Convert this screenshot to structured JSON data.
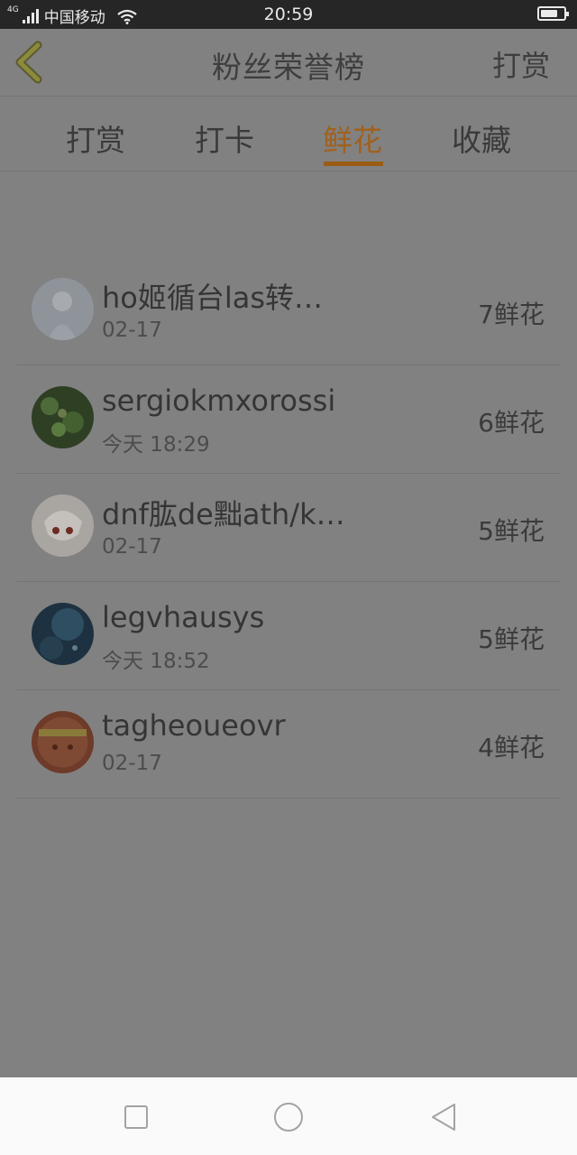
{
  "status_bar": {
    "network": "4G",
    "carrier": "中国移动",
    "time": "20:59",
    "battery_level": 0.75
  },
  "header": {
    "title": "粉丝荣誉榜",
    "action_label": "打赏"
  },
  "tabs": [
    {
      "label": "打赏",
      "active": false
    },
    {
      "label": "打卡",
      "active": false
    },
    {
      "label": "鲜花",
      "active": true
    },
    {
      "label": "收藏",
      "active": false
    }
  ],
  "fans": [
    {
      "name": "ho姬循台las转…",
      "date": "02-17",
      "count": "7鲜花"
    },
    {
      "name": "sergiokmxorossi",
      "date": "今天 18:29",
      "count": "6鲜花"
    },
    {
      "name": "dnf肱de黜ath/k…",
      "date": "02-17",
      "count": "5鲜花"
    },
    {
      "name": "legvhausys",
      "date": "今天 18:52",
      "count": "5鲜花"
    },
    {
      "name": "tagheoueovr",
      "date": "02-17",
      "count": "4鲜花"
    }
  ],
  "colors": {
    "overlay_bg": "#818181",
    "accent": "#9a5c14",
    "status_bar": "#262626",
    "nav_bar": "#fafafa"
  },
  "icons": {
    "back": "chevron-left-icon",
    "nav_recent": "square-icon",
    "nav_home": "circle-icon",
    "nav_back": "triangle-left-icon"
  }
}
